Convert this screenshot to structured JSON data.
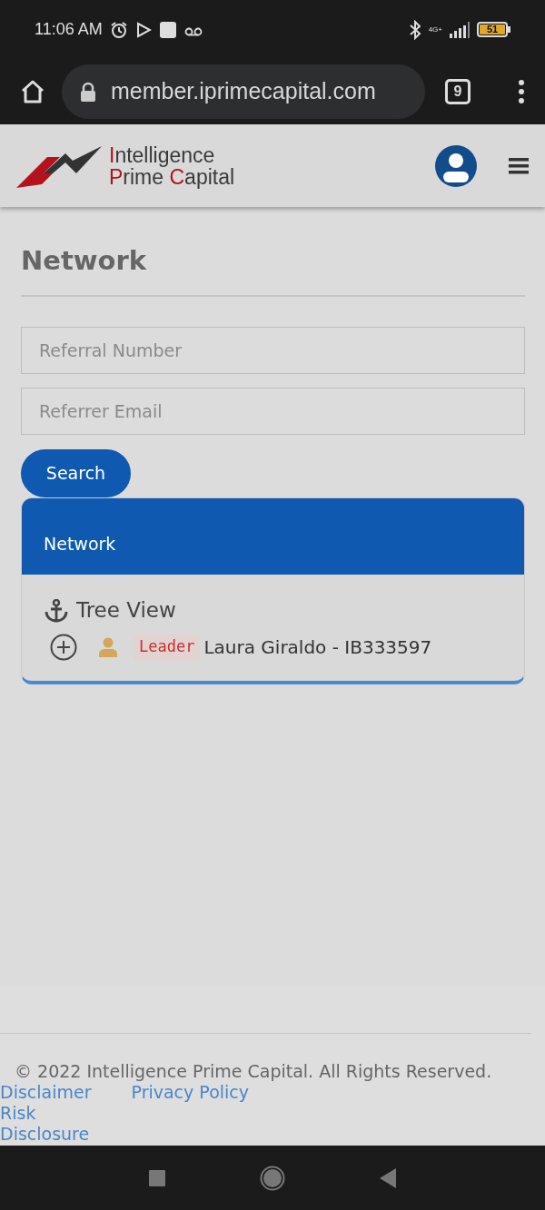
{
  "status_bar": {
    "time": "11:06 AM",
    "network": "4G+",
    "battery": "51"
  },
  "browser": {
    "url": "member.iprimecapital.com",
    "tab_count": "9"
  },
  "header": {
    "logo_lines": [
      {
        "segments": [
          {
            "text": "I",
            "accent": true
          },
          {
            "text": "ntelligence",
            "accent": false
          }
        ]
      },
      {
        "segments": [
          {
            "text": "P",
            "accent": true
          },
          {
            "text": "rime ",
            "accent": false
          },
          {
            "text": "C",
            "accent": true
          },
          {
            "text": "apital",
            "accent": false
          }
        ]
      }
    ]
  },
  "page": {
    "title": "Network"
  },
  "search_form": {
    "fields": [
      {
        "placeholder": "Referral Number"
      },
      {
        "placeholder": "Referrer Email"
      }
    ],
    "button": "Search"
  },
  "network_card": {
    "title": "Network",
    "section": "Tree View",
    "nodes": [
      {
        "expanded": false,
        "role": "Leader",
        "label": "Laura Giraldo - IB333597"
      }
    ]
  },
  "footer": {
    "copyright": "© 2022 Intelligence Prime Capital. All Rights Reserved.",
    "links": [
      "Disclaimer",
      "Privacy Policy",
      "Risk Disclosure"
    ]
  }
}
